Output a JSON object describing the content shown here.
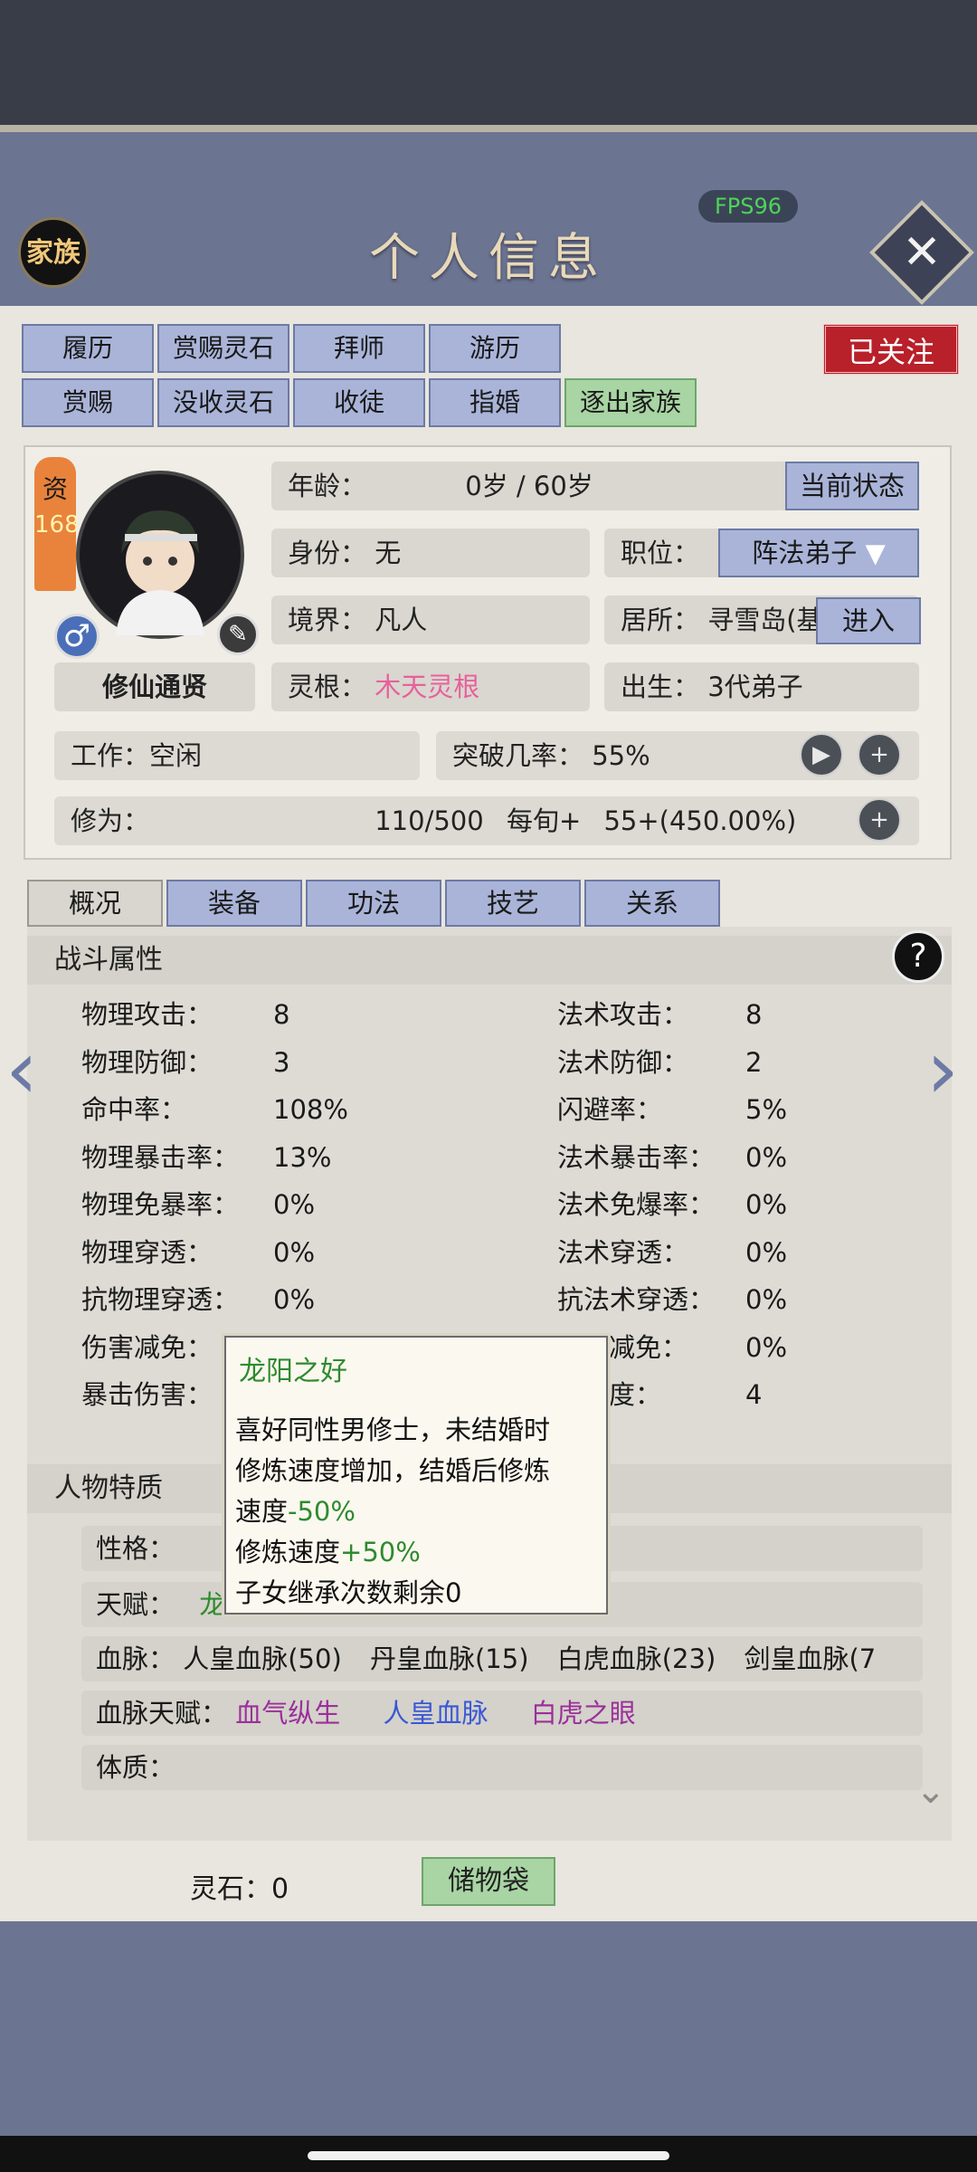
{
  "header": {
    "title": "个人信息",
    "fps": "FPS96",
    "family_badge": "家族"
  },
  "action_buttons": {
    "row1": [
      "履历",
      "赏赐灵石",
      "拜师",
      "游历"
    ],
    "row2": [
      "赏赐",
      "没收灵石",
      "收徒",
      "指婚",
      "逐出家族"
    ],
    "follow": "已关注"
  },
  "profile": {
    "zi_label": "资",
    "zi_value": "168",
    "title_badge": "修仙通贤",
    "age_label": "年龄：",
    "age_value": "0岁 / 60岁",
    "current_state_button": "当前状态",
    "identity_label": "身份：",
    "identity_value": "无",
    "position_label": "职位：",
    "position_value": "阵法弟子",
    "realm_label": "境界：",
    "realm_value": "凡人",
    "residence_label": "居所：",
    "residence_value": "寻雪岛(基",
    "enter_button": "进入",
    "root_label": "灵根：",
    "root_value": "木天灵根",
    "birth_label": "出生：",
    "birth_value": "3代弟子",
    "work": "工作：空闲",
    "breakthrough_label": "突破几率：",
    "breakthrough_value": "55%",
    "cultivation_label": "修为：",
    "cultivation_value": "110/500",
    "per_term_label": "每旬+",
    "per_term_value": "55+(450.00%)"
  },
  "sub_tabs": [
    "概况",
    "装备",
    "功法",
    "技艺",
    "关系"
  ],
  "combat": {
    "title": "战斗属性",
    "help": "?",
    "left": [
      {
        "label": "物理攻击：",
        "value": "8"
      },
      {
        "label": "物理防御：",
        "value": "3"
      },
      {
        "label": "命中率：",
        "value": "108%"
      },
      {
        "label": "物理暴击率：",
        "value": "13%"
      },
      {
        "label": "物理免暴率：",
        "value": "0%"
      },
      {
        "label": "物理穿透：",
        "value": "0%"
      },
      {
        "label": "抗物理穿透：",
        "value": "0%"
      },
      {
        "label": "伤害减免：",
        "value": ""
      },
      {
        "label": "暴击伤害：",
        "value": ""
      }
    ],
    "right": [
      {
        "label": "法术攻击：",
        "value": "8"
      },
      {
        "label": "法术防御：",
        "value": "2"
      },
      {
        "label": "闪避率：",
        "value": "5%"
      },
      {
        "label": "法术暴击率：",
        "value": "0%"
      },
      {
        "label": "法术免爆率：",
        "value": "0%"
      },
      {
        "label": "法术穿透：",
        "value": "0%"
      },
      {
        "label": "抗法术穿透：",
        "value": "0%"
      },
      {
        "label": "害减免：",
        "value": "0%"
      },
      {
        "label": "速度：",
        "value": "4"
      }
    ]
  },
  "traits": {
    "title": "人物特质",
    "personality_label": "性格：",
    "talent_label": "天赋：",
    "talent_value": "龙",
    "bloodline_label": "血脉：",
    "bloodlines": [
      "人皇血脉(50)",
      "丹皇血脉(15)",
      "白虎血脉(23)",
      "剑皇血脉(7"
    ],
    "bloodline_talent_label": "血脉天赋：",
    "bloodline_talents": [
      "血气纵生",
      "人皇血脉",
      "白虎之眼"
    ],
    "physique_label": "体质："
  },
  "popup": {
    "title": "龙阳之好",
    "line1": "喜好同性男修士，未结婚时",
    "line2": "修炼速度增加，结婚后修炼",
    "line3_prefix": "速度",
    "line3_value": "-50%",
    "line4_prefix": "修炼速度",
    "line4_value": "+50%",
    "line5": "子女继承次数剩余0"
  },
  "footer": {
    "spirit_stone": "灵石：0",
    "storage_bag": "储物袋"
  },
  "colors": {
    "accent_blue": "#a9b4d8",
    "green": "#2e8a2e",
    "pink": "#e8609a",
    "purple": "#9b2f9b",
    "red": "#b8202a"
  }
}
